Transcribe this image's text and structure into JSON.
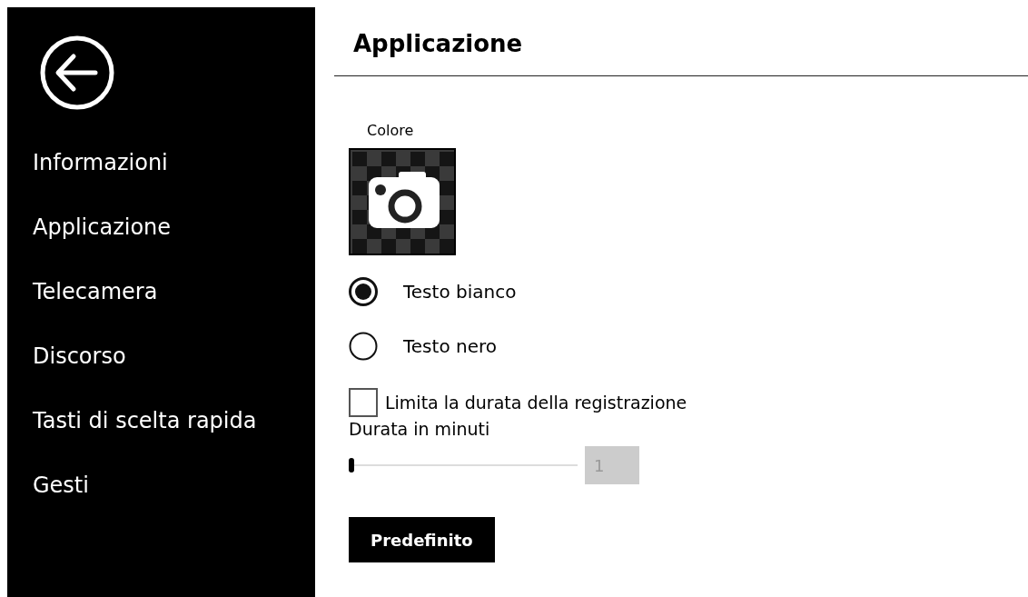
{
  "sidebar": {
    "items": [
      {
        "label": "Informazioni"
      },
      {
        "label": "Applicazione"
      },
      {
        "label": "Telecamera"
      },
      {
        "label": "Discorso"
      },
      {
        "label": "Tasti di scelta rapida"
      },
      {
        "label": "Gesti"
      }
    ]
  },
  "page": {
    "title": "Applicazione",
    "color_label": "Colore",
    "text_color_options": [
      {
        "label": "Testo bianco",
        "selected": true
      },
      {
        "label": "Testo nero",
        "selected": false
      }
    ],
    "limit": {
      "label": "Limita la durata della registrazione",
      "checked": false
    },
    "duration": {
      "label": "Durata in minuti",
      "level": 0,
      "value": "1"
    },
    "default_button": "Predefinito"
  }
}
